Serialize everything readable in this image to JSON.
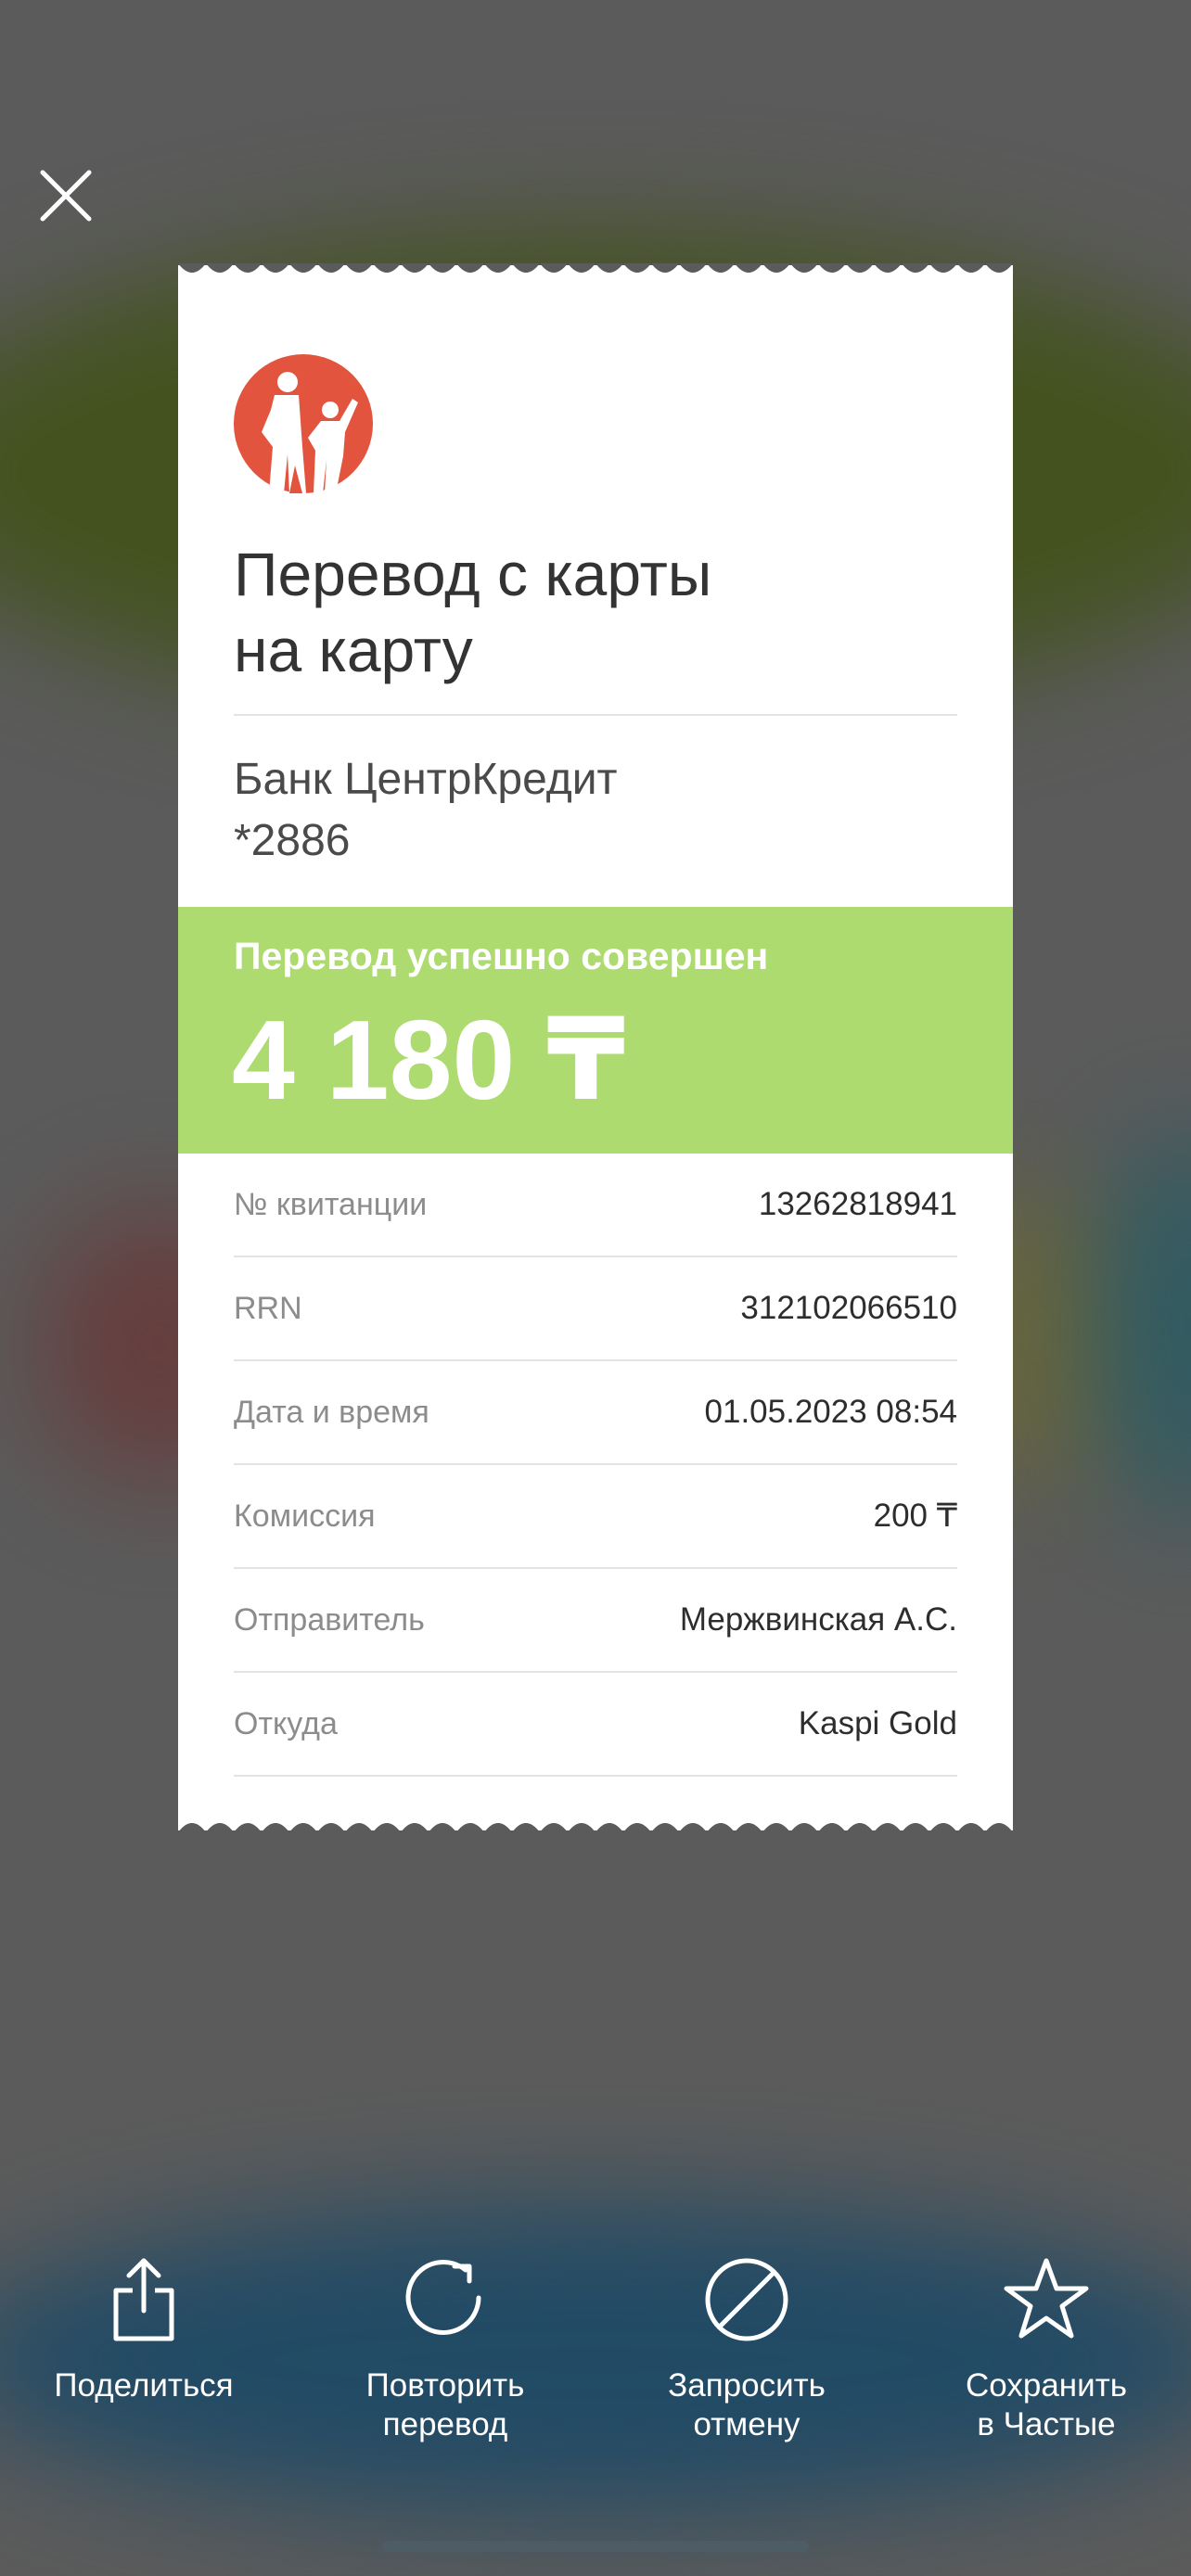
{
  "close_icon": "close-icon",
  "receipt": {
    "title": "Перевод с карты\nна карту",
    "bank_name": "Банк ЦентрКредит",
    "card_mask": "*2886",
    "status_text": "Перевод успешно совершен",
    "amount": "4 180 ₸",
    "status_color": "#addb70",
    "logo_color": "#e2543e",
    "rows": [
      {
        "label": "№ квитанции",
        "value": "13262818941"
      },
      {
        "label": "RRN",
        "value": "312102066510"
      },
      {
        "label": "Дата и время",
        "value": "01.05.2023 08:54"
      },
      {
        "label": "Комиссия",
        "value": "200 ₸"
      },
      {
        "label": "Отправитель",
        "value": "Мержвинская А.С."
      },
      {
        "label": "Откуда",
        "value": "Kaspi Gold"
      }
    ]
  },
  "actions": [
    {
      "label": "Поделиться",
      "icon": "share-icon"
    },
    {
      "label": "Повторить\nперевод",
      "icon": "repeat-icon"
    },
    {
      "label": "Запросить\nотмену",
      "icon": "cancel-icon"
    },
    {
      "label": "Сохранить\nв Частые",
      "icon": "star-icon"
    }
  ]
}
